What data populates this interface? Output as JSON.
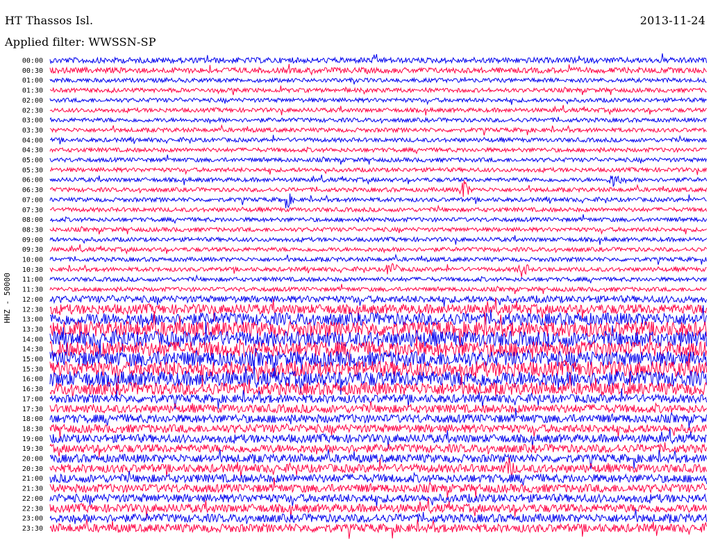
{
  "header": {
    "station": "HT Thassos Isl.",
    "date": "2013-11-24",
    "filter": "Applied filter: WWSSN-SP"
  },
  "axis": {
    "ylabel": "HHZ - 50000"
  },
  "chart_data": {
    "type": "line",
    "title": "HT Thassos Isl.",
    "subtitle": "Applied filter: WWSSN-SP",
    "date": "2013-11-24",
    "ylabel": "HHZ - 50000",
    "grid": false,
    "colors": [
      "#0000ee",
      "#ff0044"
    ],
    "row_labels": [
      "00:00",
      "00:30",
      "01:00",
      "01:30",
      "02:00",
      "02:30",
      "03:00",
      "03:30",
      "04:00",
      "04:30",
      "05:00",
      "05:30",
      "06:00",
      "06:30",
      "07:00",
      "07:30",
      "08:00",
      "08:30",
      "09:00",
      "09:30",
      "10:00",
      "10:30",
      "11:00",
      "11:30",
      "12:00",
      "12:30",
      "13:00",
      "13:30",
      "14:00",
      "14:30",
      "15:00",
      "15:30",
      "16:00",
      "16:30",
      "17:00",
      "17:30",
      "18:00",
      "18:30",
      "19:00",
      "19:30",
      "20:00",
      "20:30",
      "21:00",
      "21:30",
      "22:00",
      "22:30",
      "23:00",
      "23:30"
    ],
    "noise_level": [
      4,
      4,
      3,
      3,
      3,
      3,
      3,
      3,
      3,
      3,
      3,
      3,
      3,
      3,
      3,
      3,
      3,
      3,
      3,
      3,
      3,
      3,
      3,
      3,
      5,
      7,
      9,
      11,
      11,
      11,
      11,
      11,
      11,
      9,
      6,
      6,
      6,
      6,
      6,
      6,
      6,
      6,
      6,
      6,
      6,
      6,
      6,
      6
    ],
    "events": [
      {
        "row": 12,
        "position": 0.86,
        "amplitude": 14
      },
      {
        "row": 13,
        "position": 0.63,
        "amplitude": 16
      },
      {
        "row": 14,
        "position": 0.36,
        "amplitude": 14
      },
      {
        "row": 21,
        "position": 0.52,
        "amplitude": 14
      },
      {
        "row": 21,
        "position": 0.72,
        "amplitude": 13
      },
      {
        "row": 41,
        "position": 0.7,
        "amplitude": 18
      }
    ]
  }
}
